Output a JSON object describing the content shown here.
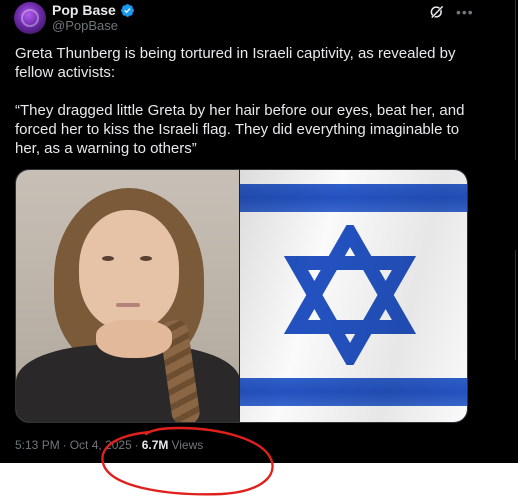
{
  "post": {
    "author": {
      "display_name": "Pop Base",
      "handle": "@PopBase",
      "verified": true
    },
    "icons": {
      "avatar": "avatar",
      "verified": "verified-badge-icon",
      "grok": "grok-icon",
      "more": "more-options-icon"
    },
    "text": "Greta Thunberg is being tortured in Israeli captivity, as revealed by fellow activists:\n\n“They dragged little Greta by her hair before our eyes, beat her, and forced her to kiss the Israeli flag. They did everything imaginable to her, as a warning to others”",
    "media": {
      "left_image": "portrait-photo",
      "right_image": "israeli-flag-photo"
    },
    "meta": {
      "time": "5:13 PM",
      "separator1": "·",
      "date": "Oct 4, 2025",
      "separator2": "·",
      "views_count": "6.7M",
      "views_label": "Views"
    }
  },
  "colors": {
    "background": "#000000",
    "text_primary": "#e7e9ea",
    "text_secondary": "#71767b",
    "verified_blue": "#1d9bf0",
    "annotation_red": "#e0201c",
    "flag_blue": "#2352c0"
  }
}
